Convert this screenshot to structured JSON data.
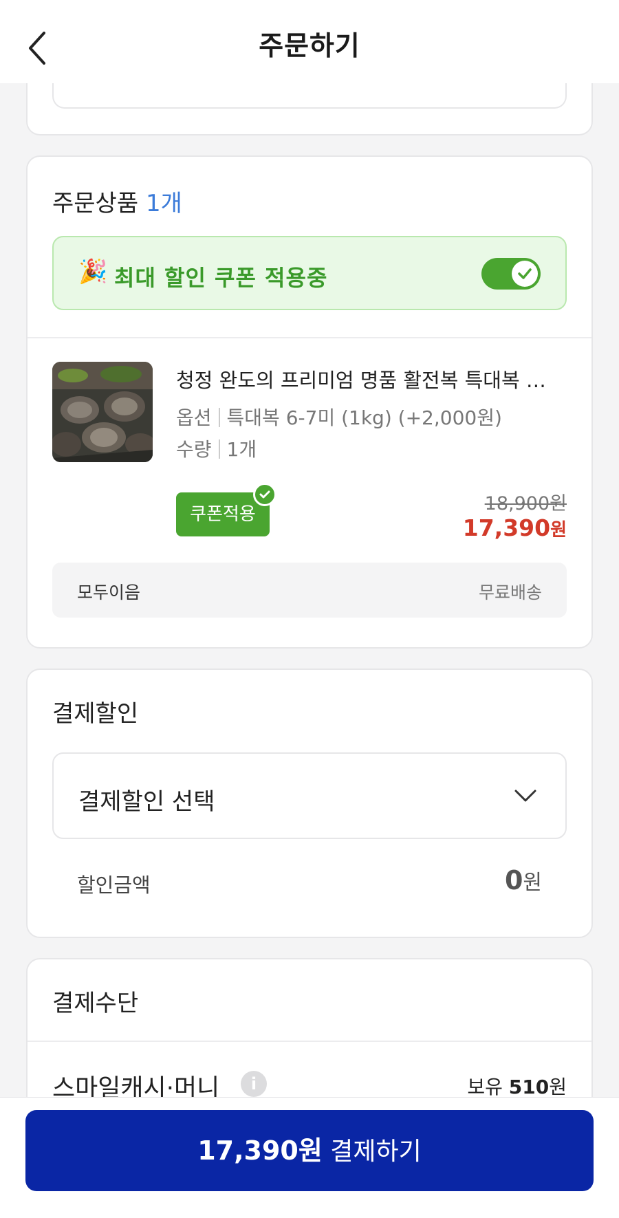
{
  "header": {
    "title": "주문하기"
  },
  "order": {
    "title": "주문상품",
    "count": "1개",
    "coupon_banner": {
      "text": "최대 할인 쿠폰 적용중",
      "toggle_on": true
    },
    "product": {
      "name": "청정 완도의 프리미엄 명품 활전복 특대복 …",
      "option_label": "옵션",
      "option_value": "특대복 6-7미 (1kg) (+2,000원)",
      "qty_label": "수량",
      "qty_value": "1개",
      "coupon_badge": "쿠폰적용",
      "price_original": "18,900원",
      "price_sale": "17,390",
      "price_sale_unit": "원"
    },
    "shipping": {
      "seller": "모두이음",
      "fee": "무료배송"
    }
  },
  "discount": {
    "title": "결제할인",
    "select_label": "결제할인 선택",
    "amount_label": "할인금액",
    "amount_value": "0",
    "amount_unit": "원"
  },
  "payment": {
    "title": "결제수단",
    "method_name": "스마일캐시·머니",
    "balance_prefix": "보유 ",
    "balance_value": "510",
    "balance_unit": "원"
  },
  "footer": {
    "amount": "17,390원",
    "action": " 결제하기"
  },
  "colors": {
    "accent_blue": "#0a26a5",
    "green": "#4aa530",
    "sale_red": "#d23a29",
    "count_blue": "#3b7bd9"
  }
}
